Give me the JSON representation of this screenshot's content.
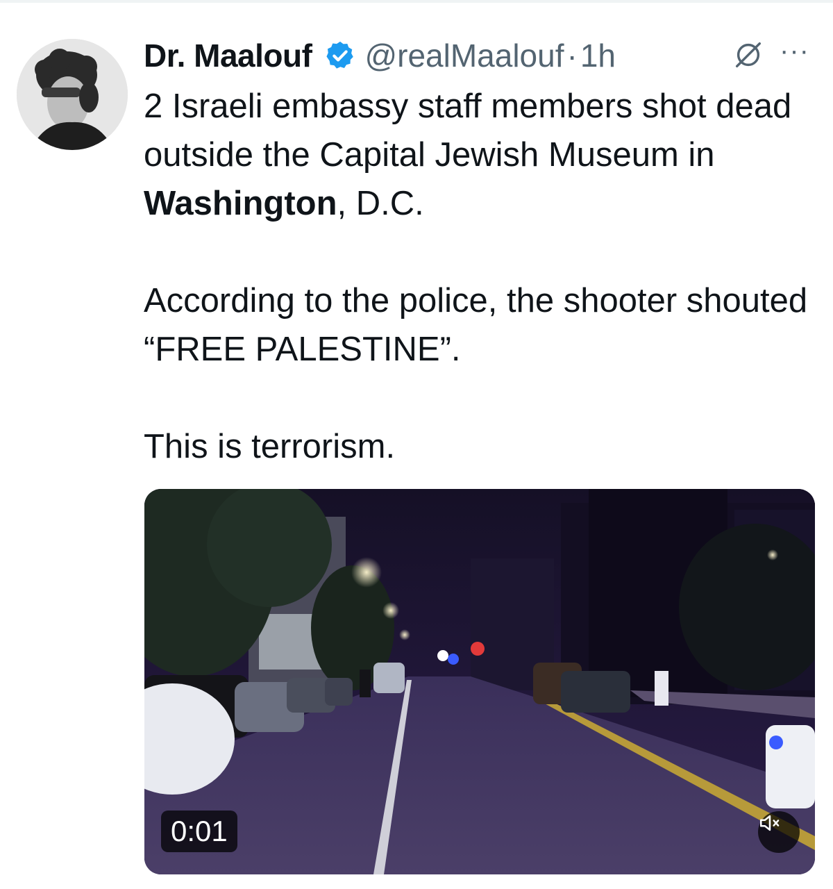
{
  "tweet": {
    "author_name": "Dr. Maalouf",
    "handle": "@realMaalouf",
    "separator": "·",
    "timestamp": "1h",
    "more_label": "···",
    "text_line1": "2 Israeli embassy staff members shot dead outside the Capital Jewish Museum in ",
    "text_bold": "Washington",
    "text_line1_end": ", D.C.",
    "paragraph2": "According to the police, the shooter shouted “FREE PALESTINE”.",
    "paragraph3": "This is terrorism."
  },
  "media": {
    "duration": "0:01",
    "muted": true
  },
  "icons": {
    "verified": "verified-badge-icon",
    "grok": "grok-icon",
    "more": "more-icon",
    "mute": "speaker-muted-icon"
  },
  "colors": {
    "verified": "#1d9bf0",
    "text": "#0f1419",
    "secondary": "#536471"
  }
}
